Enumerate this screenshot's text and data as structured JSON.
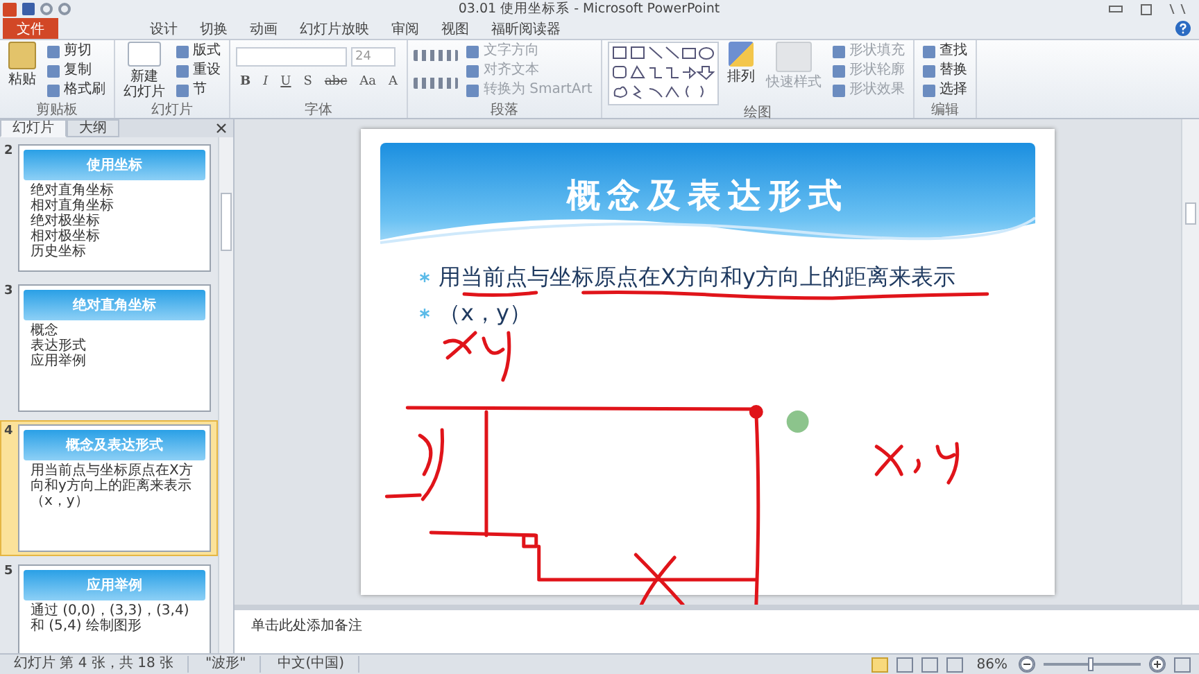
{
  "window": {
    "title": "03.01 使用坐标系 - Microsoft PowerPoint"
  },
  "ribbon_tabs": [
    {
      "label": "文件",
      "kind": "file",
      "selected": false
    },
    {
      "label": "设计",
      "kind": "tab",
      "selected": false
    },
    {
      "label": "切换",
      "kind": "tab",
      "selected": false
    },
    {
      "label": "动画",
      "kind": "tab",
      "selected": false
    },
    {
      "label": "幻灯片放映",
      "kind": "tab",
      "selected": false
    },
    {
      "label": "审阅",
      "kind": "tab",
      "selected": false
    },
    {
      "label": "视图",
      "kind": "tab",
      "selected": false
    },
    {
      "label": "福昕阅读器",
      "kind": "tab",
      "selected": false
    }
  ],
  "clipboard": {
    "label": "剪贴板",
    "paste": "粘贴",
    "items": [
      "剪切",
      "复制",
      "格式刷"
    ]
  },
  "slides_group": {
    "label": "幻灯片",
    "new_slide": [
      "新建",
      "幻灯片"
    ],
    "items": [
      "版式",
      "重设",
      "节"
    ]
  },
  "font": {
    "label": "字体",
    "size": "24",
    "format_buttons": [
      "B",
      "I",
      "U",
      "S",
      "abc",
      "Aa",
      "A"
    ]
  },
  "paragraph": {
    "label": "段落",
    "items": [
      "文字方向",
      "对齐文本",
      "转换为 SmartArt"
    ]
  },
  "drawing": {
    "label": "绘图",
    "arrange": "排列",
    "quick_styles": "快速样式",
    "items": [
      "形状填充",
      "形状轮廓",
      "形状效果"
    ]
  },
  "editing": {
    "label": "编辑",
    "items": [
      "查找",
      "替换",
      "选择"
    ]
  },
  "panel_tabs": [
    {
      "label": "幻灯片",
      "selected": true
    },
    {
      "label": "大纲",
      "selected": false
    }
  ],
  "thumbnails": [
    {
      "number": "2",
      "title": "使用坐标",
      "bullets": [
        "绝对直角坐标",
        "相对直角坐标",
        "绝对极坐标",
        "相对极坐标",
        "历史坐标"
      ],
      "selected": false
    },
    {
      "number": "3",
      "title": "绝对直角坐标",
      "bullets": [
        "概念",
        "表达形式",
        "应用举例"
      ],
      "selected": false
    },
    {
      "number": "4",
      "title": "概念及表达形式",
      "bullets": [
        "用当前点与坐标原点在X方向和y方向上的距离来表示",
        "（x，y）"
      ],
      "selected": true
    },
    {
      "number": "5",
      "title": "应用举例",
      "bullets": [
        "通过 (0,0)，(3,3)，(3,4) 和 (5,4) 绘制图形"
      ],
      "selected": false
    }
  ],
  "slide": {
    "title": "概念及表达形式",
    "bullets": [
      "用当前点与坐标原点在X方向和y方向上的距离来表示",
      "（x，y）"
    ]
  },
  "notes": {
    "placeholder": "单击此处添加备注"
  },
  "status_bar": {
    "items": [
      "幻灯片 第 4 张，共 18 张",
      "\"波形\"",
      "中文(中国)"
    ],
    "zoom": "86%",
    "zoom_slider": {
      "level": 0.48
    }
  }
}
